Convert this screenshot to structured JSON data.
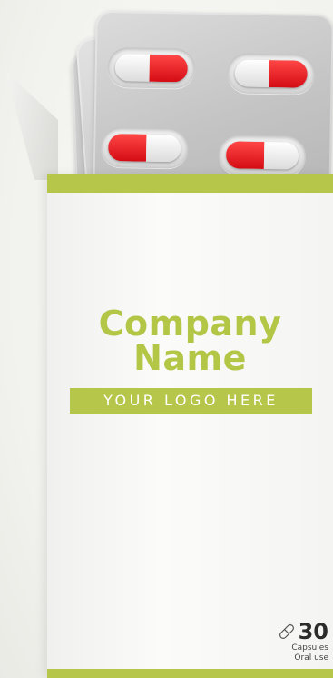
{
  "brand": {
    "company_line1": "Company",
    "company_line2": "Name",
    "logo_text": "YOUR LOGO HERE",
    "accent_color": "#b6c64a"
  },
  "pack": {
    "count": "30",
    "unit": "Capsules",
    "route": "Oral use",
    "icon": "pill-icon"
  },
  "capsule_colors": [
    "#ffffff",
    "#e0121a"
  ]
}
